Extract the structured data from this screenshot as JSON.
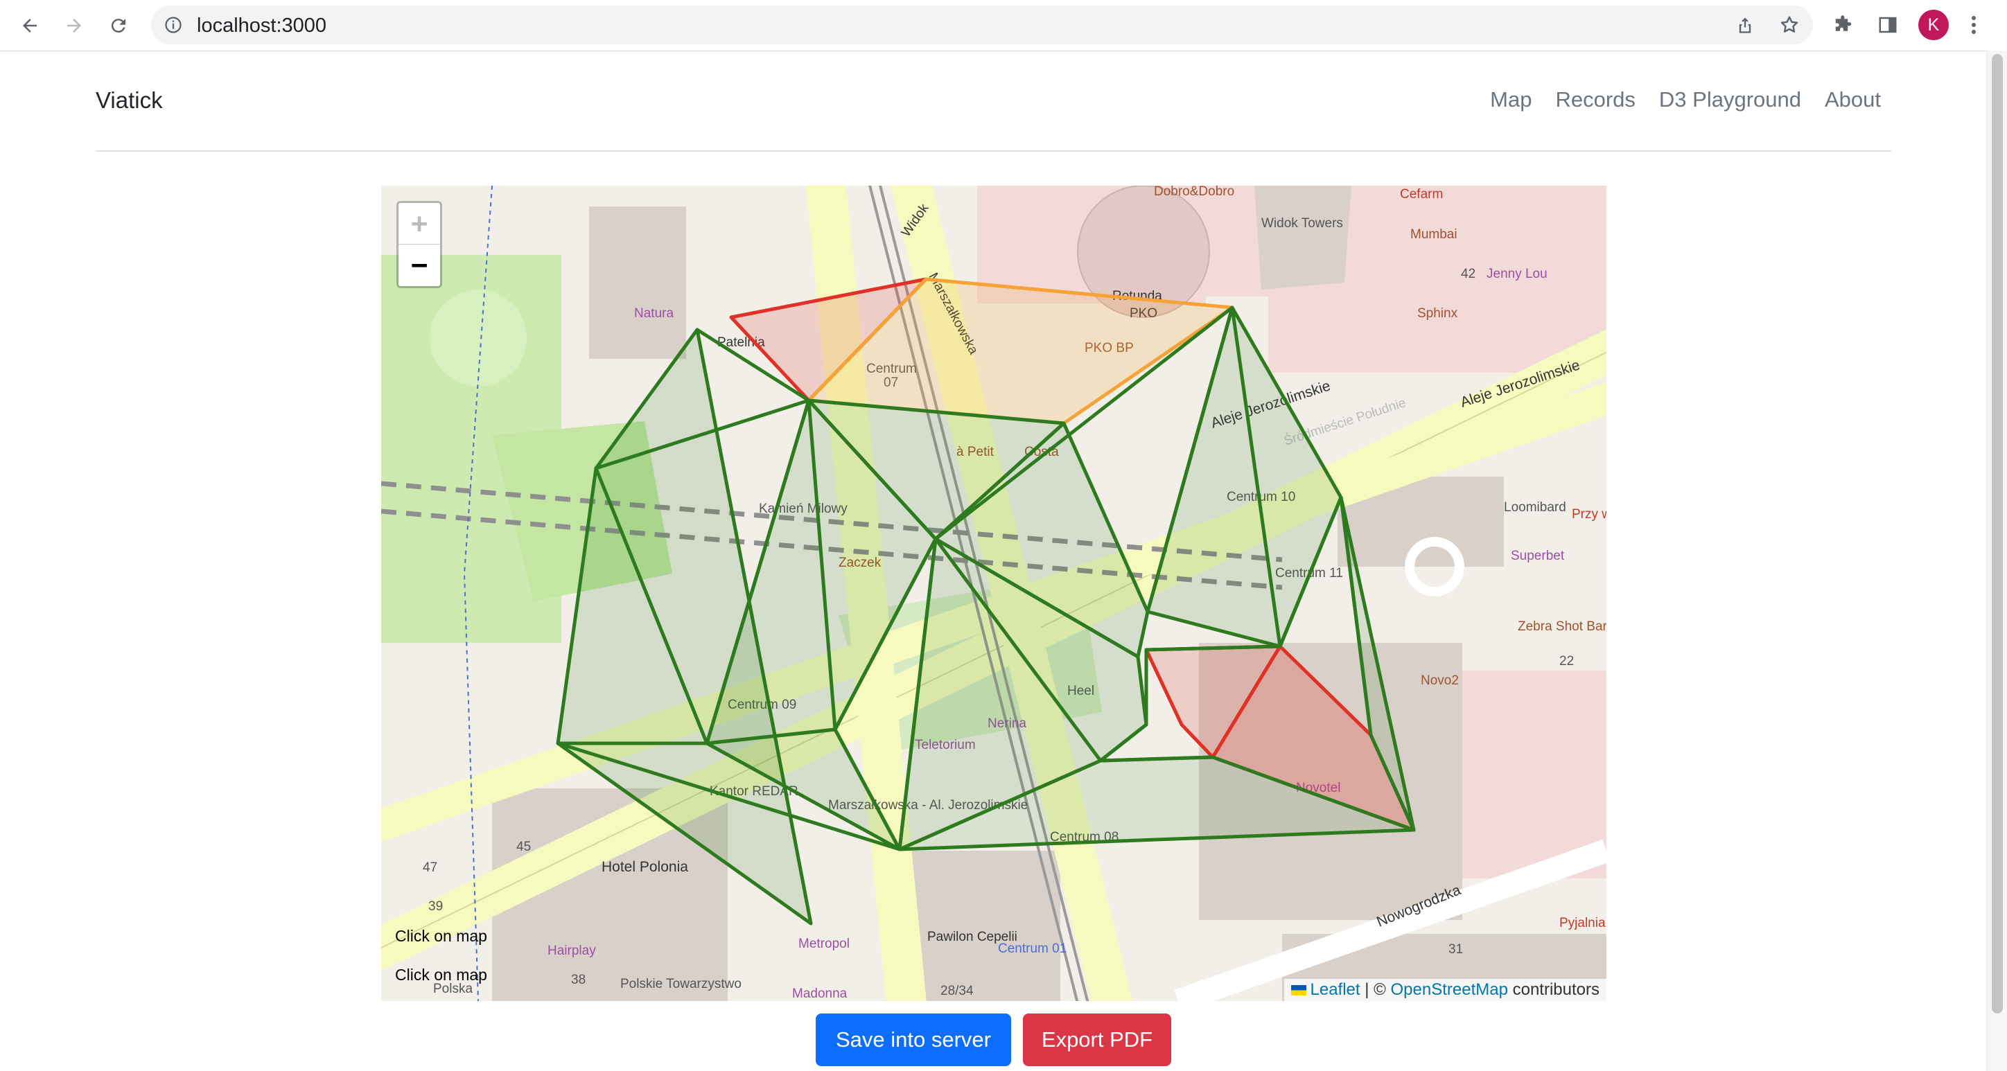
{
  "browser": {
    "url": "localhost:3000",
    "profile_initial": "K",
    "icons": [
      "back-icon",
      "forward-icon",
      "reload-icon",
      "info-icon",
      "share-icon",
      "star-icon",
      "extensions-icon",
      "side-panel-icon",
      "kebab-menu-icon"
    ]
  },
  "navbar": {
    "brand": "Viatick",
    "links": [
      "Map",
      "Records",
      "D3 Playground",
      "About"
    ]
  },
  "map": {
    "zoom_in": "+",
    "zoom_out": "−",
    "notes": [
      "Click on map",
      "Click on map"
    ],
    "attribution": {
      "leaflet": "Leaflet",
      "separator": "| ©",
      "osm": "OpenStreetMap",
      "suffix": "contributors"
    },
    "labels": [
      "Dobro&Dobro",
      "Cefarm",
      "Mumbai",
      "Widok Towers",
      "Widok",
      "Rotunda",
      "PKO",
      "PKO BP",
      "Marszałkowska",
      "Natura",
      "Patelnia",
      "Centrum",
      "07",
      "Sphinx",
      "42",
      "Jenny Lou",
      "Aleje Jerozolimskie",
      "Śródmieście Południe",
      "à Petit",
      "Costa",
      "Centrum 10",
      "Kamień Milowy",
      "Zaczek",
      "Loomibard",
      "Superbet",
      "Przy weterynarz",
      "Centrum 11",
      "Centrum 09",
      "Novo2",
      "Zebra Shot Bar",
      "22",
      "Heel",
      "Nerina",
      "Teletorium",
      "Novotel",
      "Kantor REDAR",
      "45",
      "Hotel Polonia",
      "Marszałkowska - Al. Jerozolimskie",
      "Centrum 08",
      "47",
      "39",
      "Hairplay",
      "38",
      "Polskie Towarzystwo",
      "Polska",
      "Metropol",
      "Madonna",
      "Pawilon Cepelii",
      "28/34",
      "Centrum 01",
      "Nowogrodzka",
      "31",
      "Pyjalnia Wódki i Piwa"
    ],
    "colors": {
      "green": "#2d7a1f",
      "orange": "#f5a336",
      "red": "#e03127",
      "road_yellow": "#f6fabf",
      "park_green": "#cdebb0"
    }
  },
  "actions": {
    "save": "Save into server",
    "export": "Export PDF"
  }
}
